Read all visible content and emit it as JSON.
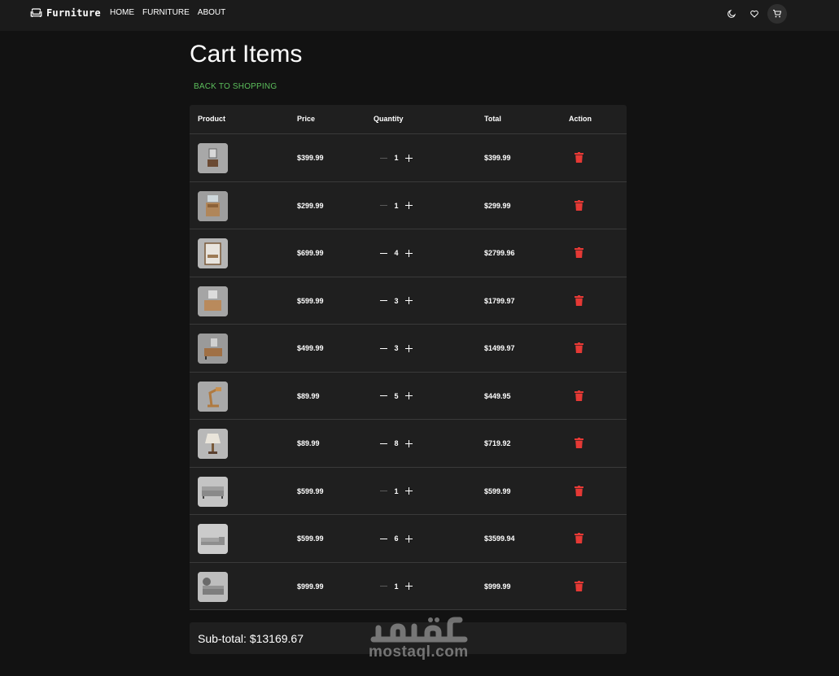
{
  "navbar": {
    "brand": "Furniture",
    "links": [
      "HOME",
      "FURNITURE",
      "ABOUT"
    ],
    "icons": [
      "moon-icon",
      "heart-icon",
      "cart-icon"
    ]
  },
  "page": {
    "title": "Cart Items",
    "back_link": "BACK TO SHOPPING"
  },
  "table": {
    "headers": [
      "Product",
      "Price",
      "Quantity",
      "Total",
      "Action"
    ],
    "rows": [
      {
        "image": "bathroom-vanity-wall",
        "price": "$399.99",
        "quantity": "1",
        "total": "$399.99",
        "minus_disabled": true
      },
      {
        "image": "bathroom-vanity-wood",
        "price": "$299.99",
        "quantity": "1",
        "total": "$299.99",
        "minus_disabled": true
      },
      {
        "image": "bathroom-cabinet-white",
        "price": "$699.99",
        "quantity": "4",
        "total": "$2799.96",
        "minus_disabled": false
      },
      {
        "image": "bathroom-vanity-oak",
        "price": "$599.99",
        "quantity": "3",
        "total": "$1799.97",
        "minus_disabled": false
      },
      {
        "image": "bathroom-vanity-dark",
        "price": "$499.99",
        "quantity": "3",
        "total": "$1499.97",
        "minus_disabled": false
      },
      {
        "image": "wooden-desk-lamp",
        "price": "$89.99",
        "quantity": "5",
        "total": "$449.95",
        "minus_disabled": false
      },
      {
        "image": "table-lamp",
        "price": "$89.99",
        "quantity": "8",
        "total": "$719.92",
        "minus_disabled": false
      },
      {
        "image": "grey-sofa",
        "price": "$599.99",
        "quantity": "1",
        "total": "$599.99",
        "minus_disabled": true
      },
      {
        "image": "sectional-sofa",
        "price": "$599.99",
        "quantity": "6",
        "total": "$3599.94",
        "minus_disabled": false
      },
      {
        "image": "living-room-sofa",
        "price": "$999.99",
        "quantity": "1",
        "total": "$999.99",
        "minus_disabled": true
      }
    ],
    "action_icon": "trash-icon"
  },
  "subtotal": {
    "label": "Sub-total: $13169.67"
  },
  "watermark": {
    "text_latin": "mostaql.com",
    "text_arabic": "مستقل"
  },
  "colors": {
    "background": "#121212",
    "navbar": "#1b1b1b",
    "card": "#1f1f1f",
    "accent_green": "#5cbf5c",
    "delete_red": "#e53935"
  }
}
